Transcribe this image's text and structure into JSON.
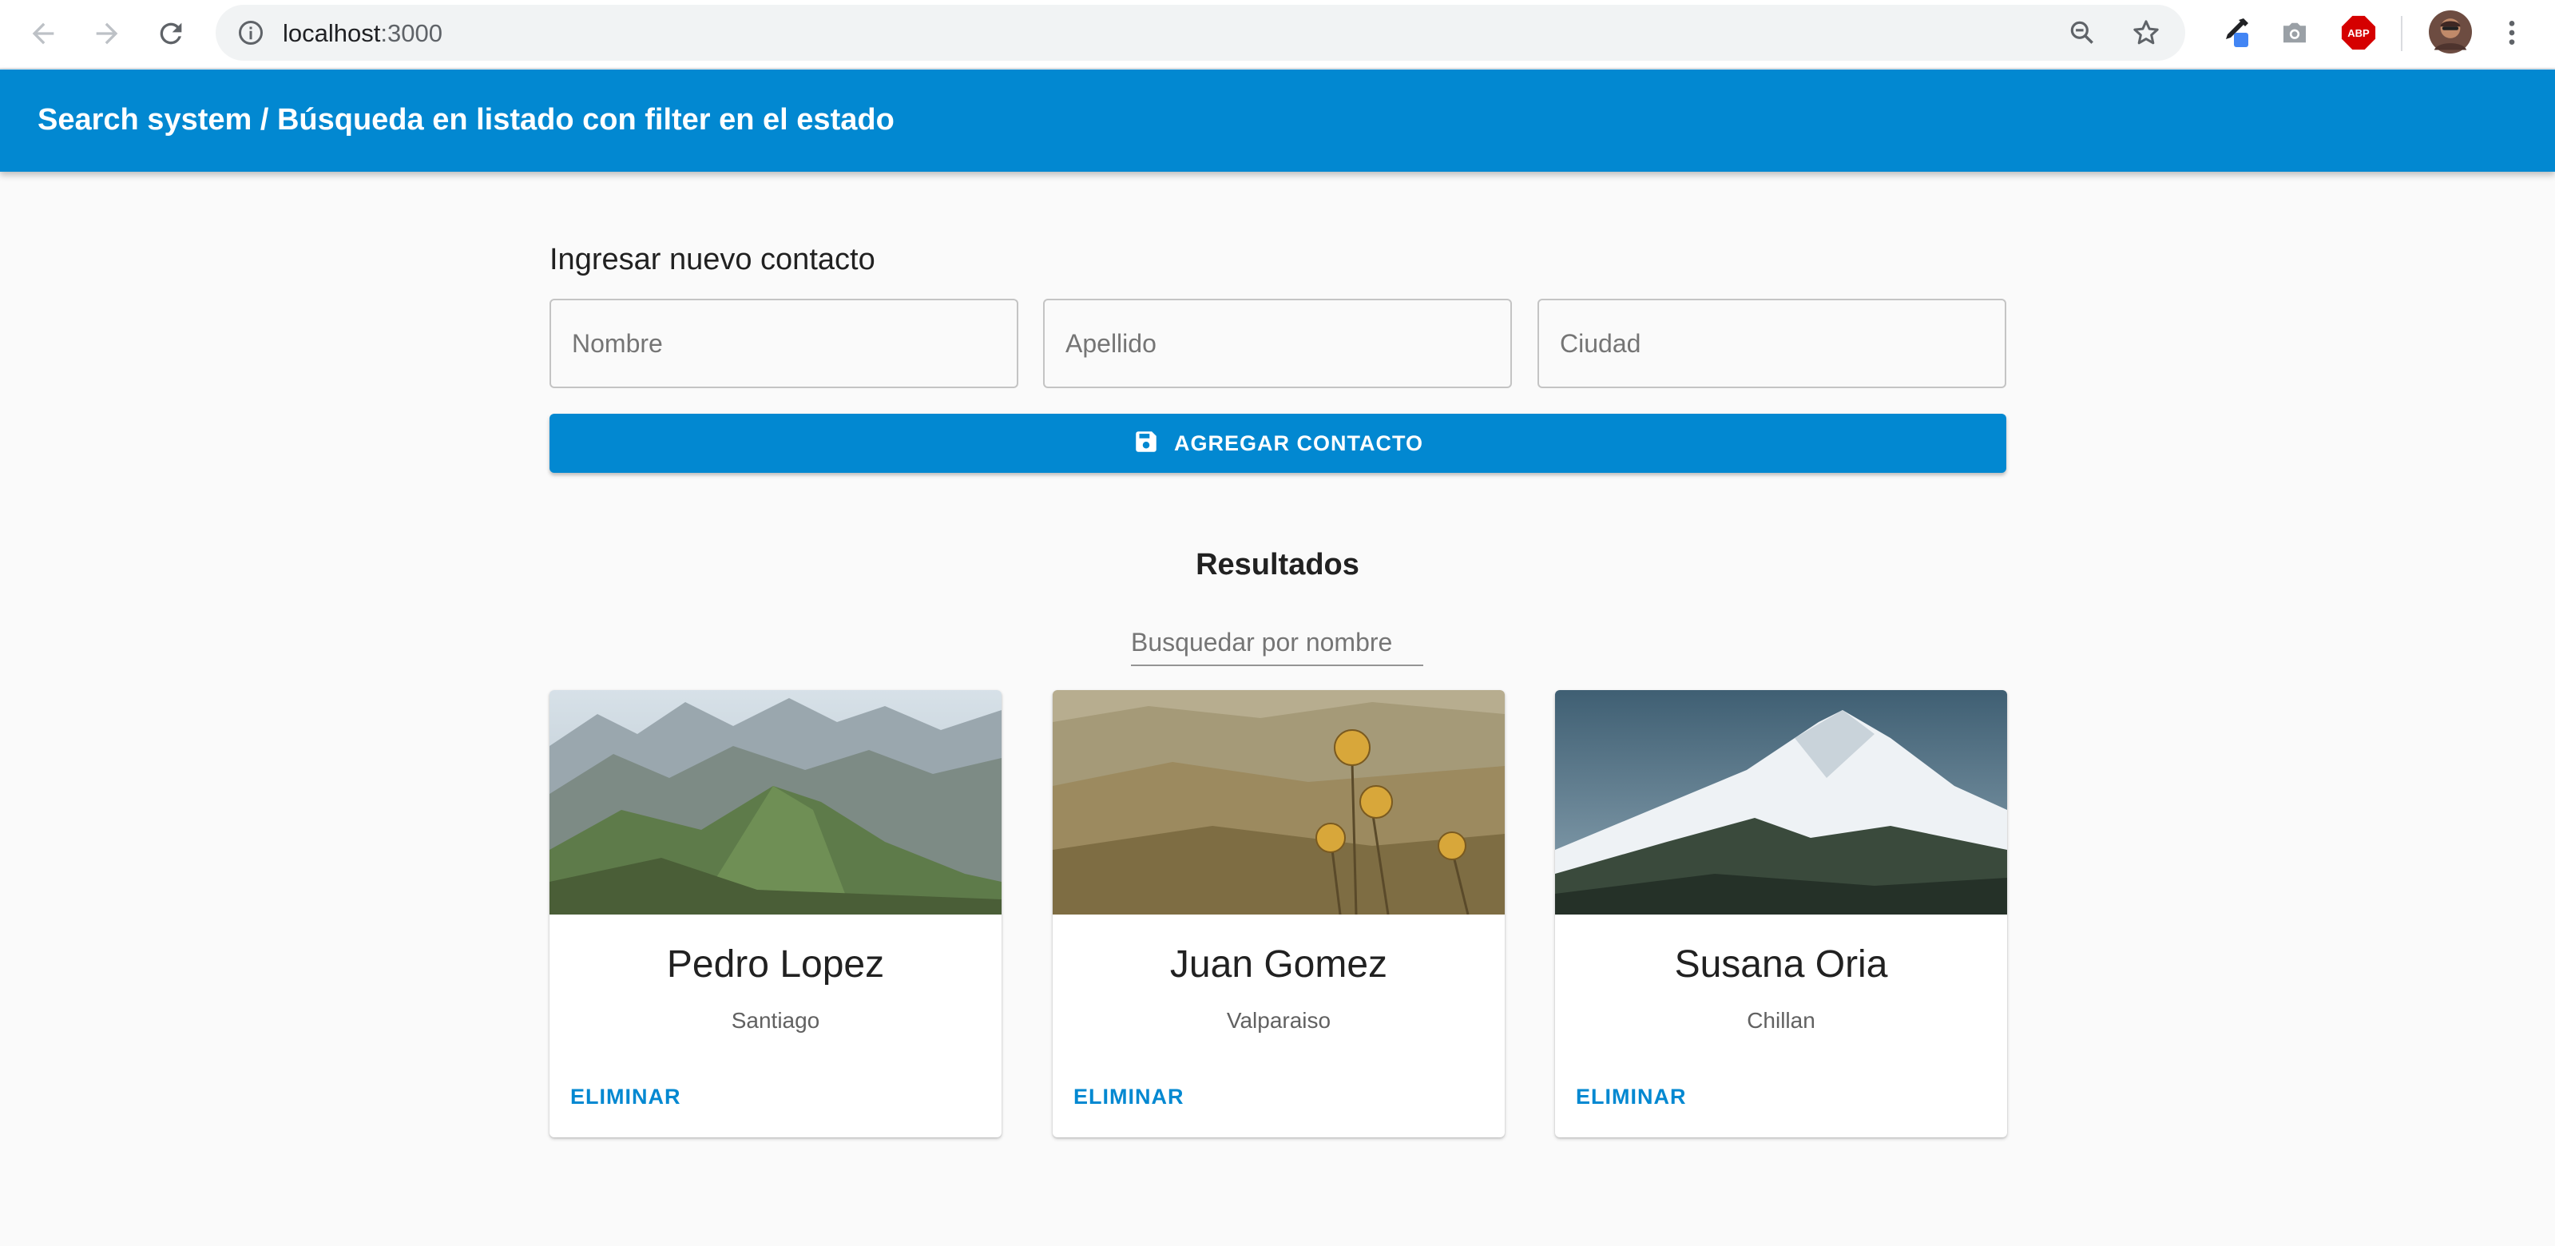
{
  "browser": {
    "url_host": "localhost",
    "url_path": ":3000",
    "icons": [
      "back-arrow-icon",
      "forward-arrow-icon",
      "reload-icon",
      "info-icon",
      "zoom-icon",
      "star-icon",
      "eyedropper-icon",
      "camera-icon",
      "adblock-icon",
      "avatar",
      "kebab-menu-icon"
    ],
    "extensions": {
      "adblock_label": "ABP"
    }
  },
  "appbar": {
    "title": "Search system / Búsqueda en listado con filter en el estado",
    "color": "#0288d1"
  },
  "form": {
    "title": "Ingresar nuevo contacto",
    "fields": [
      {
        "placeholder": "Nombre",
        "value": ""
      },
      {
        "placeholder": "Apellido",
        "value": ""
      },
      {
        "placeholder": "Ciudad",
        "value": ""
      }
    ],
    "submit_label": "AGREGAR CONTACTO",
    "submit_icon": "save-icon"
  },
  "results": {
    "title": "Resultados",
    "search_placeholder": "Busquedar por nombre",
    "cards": [
      {
        "name": "Pedro Lopez",
        "city": "Santiago",
        "action": "ELIMINAR",
        "image": "green-mountain-ridge"
      },
      {
        "name": "Juan Gomez",
        "city": "Valparaiso",
        "action": "ELIMINAR",
        "image": "thistle-flowers-landscape"
      },
      {
        "name": "Susana Oria",
        "city": "Chillan",
        "action": "ELIMINAR",
        "image": "snowy-mountain"
      }
    ]
  },
  "colors": {
    "primary": "#0288d1",
    "background": "#fafafa"
  }
}
